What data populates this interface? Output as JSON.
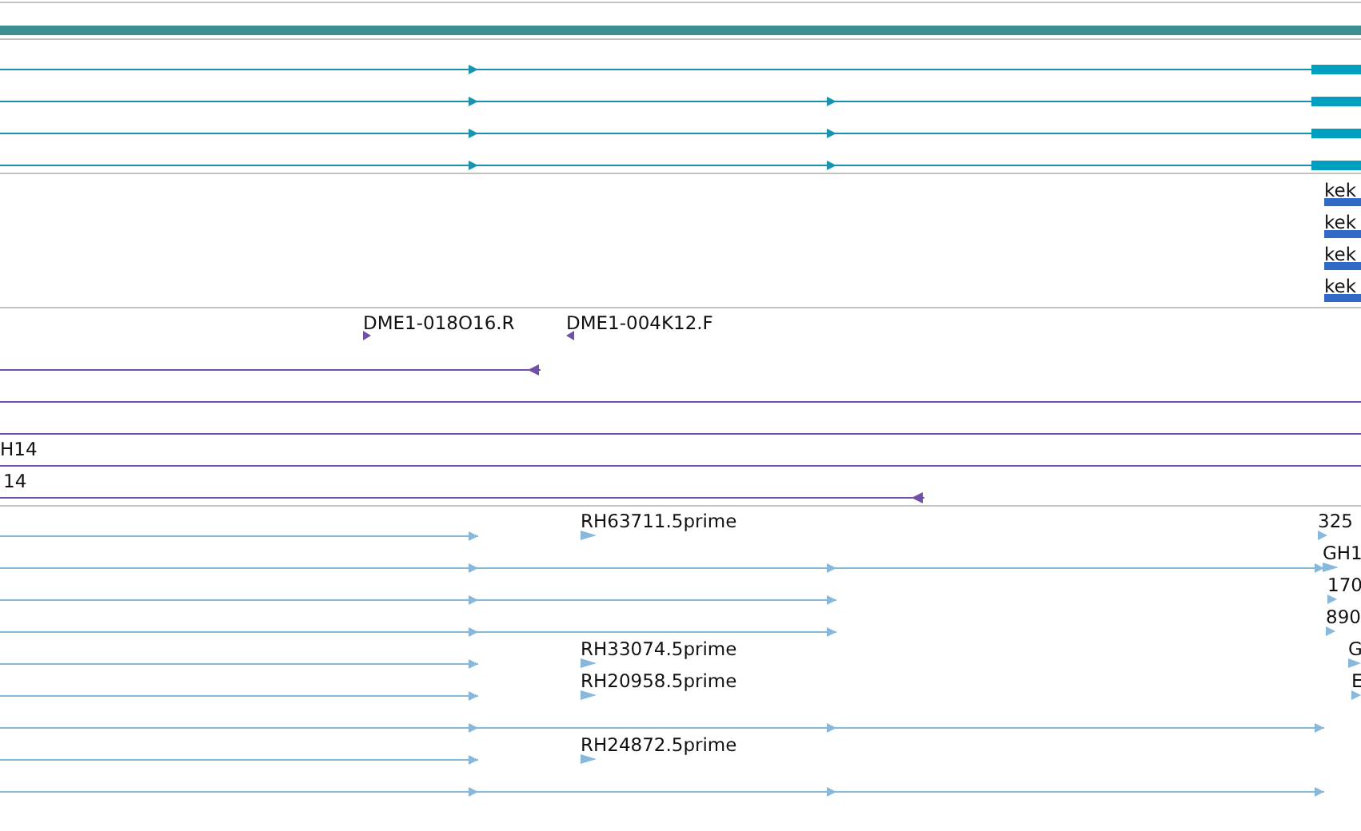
{
  "tracks": [
    {
      "kind": "scale"
    },
    {
      "kind": "transcript",
      "rows": [
        {
          "kind": "model"
        },
        {
          "kind": "model"
        },
        {
          "kind": "model"
        },
        {
          "kind": "model"
        }
      ]
    },
    {
      "kind": "protein",
      "rows": [
        {
          "labels": [
            "kek"
          ]
        },
        {
          "labels": [
            "kek"
          ]
        },
        {
          "labels": [
            "kek"
          ]
        },
        {
          "labels": [
            "kek"
          ]
        }
      ]
    },
    {
      "kind": "clone",
      "rows": [
        {
          "kind": "markers",
          "labels": [
            "DME1-018O16.R",
            "DME1-004K12.F"
          ]
        },
        {
          "kind": "model"
        },
        {
          "kind": "model"
        },
        {
          "kind": "model"
        },
        {
          "kind": "model",
          "labels": [
            "H14"
          ]
        },
        {
          "kind": "model",
          "labels": [
            "14"
          ]
        }
      ]
    },
    {
      "kind": "est",
      "rows": [
        {
          "kind": "model",
          "labels": [
            "RH63711.5prime",
            "325"
          ]
        },
        {
          "kind": "model",
          "labels": [
            "GH1"
          ]
        },
        {
          "kind": "model",
          "labels": [
            "170"
          ]
        },
        {
          "kind": "model",
          "labels": [
            "890"
          ]
        },
        {
          "kind": "model",
          "labels": [
            "RH33074.5prime",
            "G"
          ]
        },
        {
          "kind": "model",
          "labels": [
            "RH20958.5prime",
            "E"
          ]
        },
        {
          "kind": "model"
        },
        {
          "kind": "model",
          "labels": [
            "RH24872.5prime"
          ]
        },
        {
          "kind": "model"
        }
      ]
    }
  ]
}
